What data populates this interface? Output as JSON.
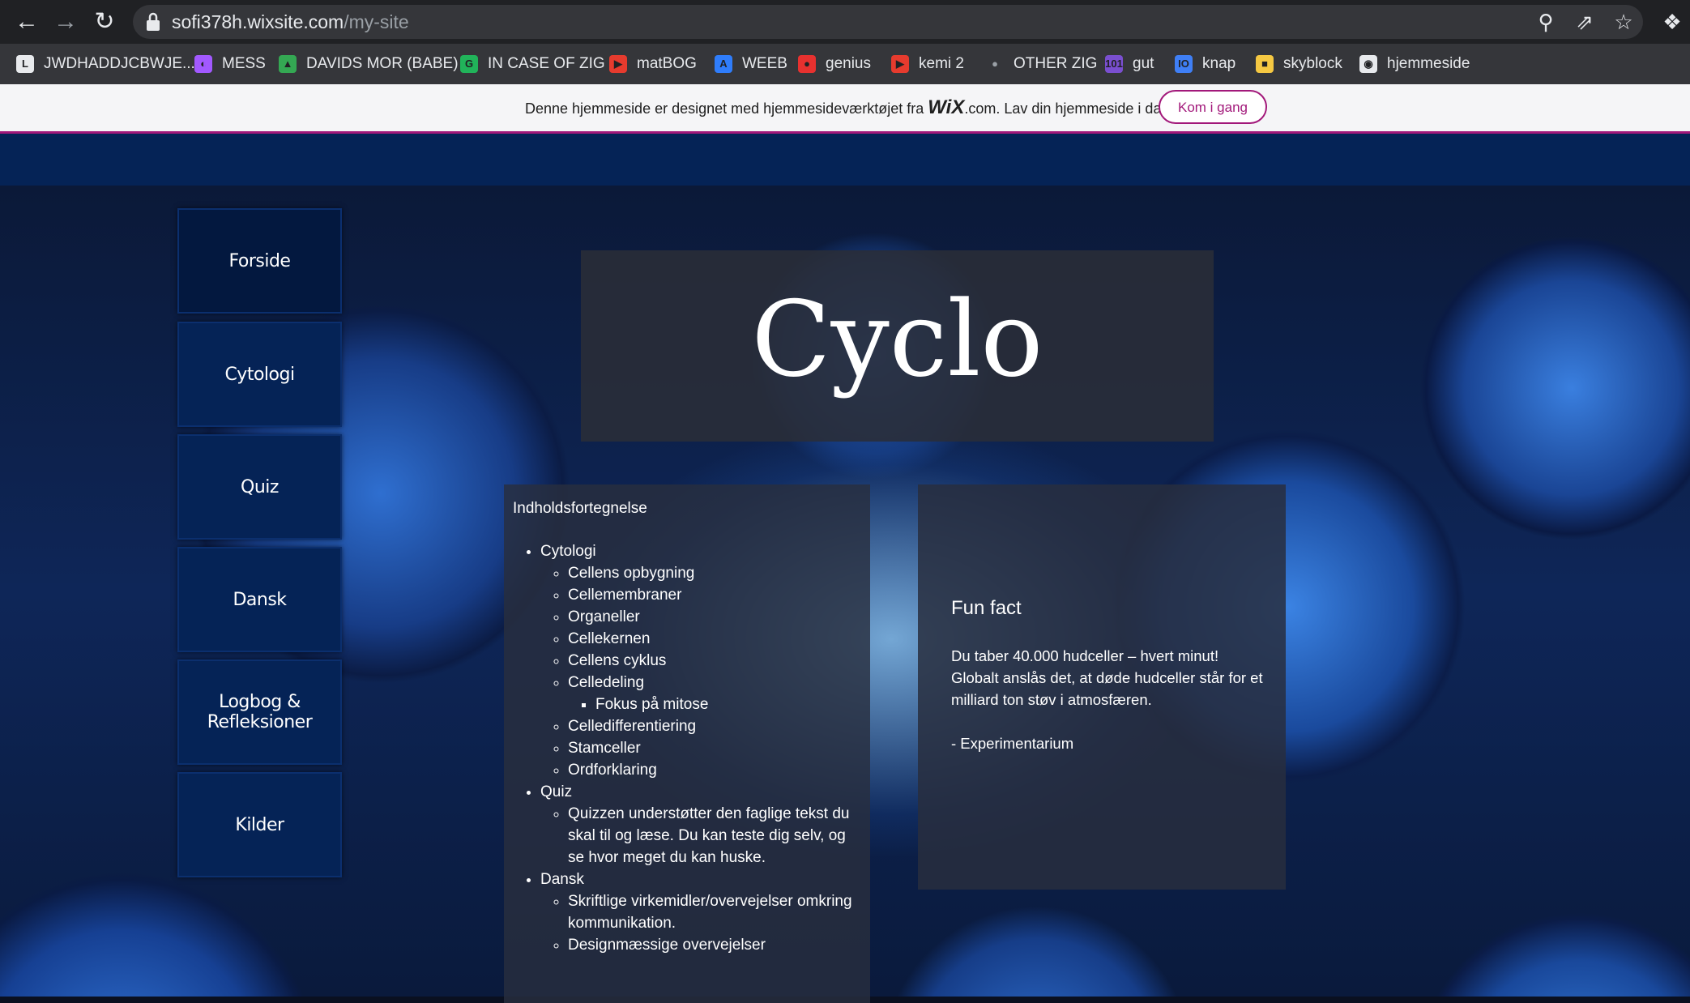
{
  "browser": {
    "url_host": "sofi378h.wixsite.com",
    "url_path": "/my-site",
    "bookmarks": [
      {
        "label": "JWDHADDJCBWJE...",
        "icon": "doc-icon",
        "color": "#e8eaed"
      },
      {
        "label": "MESS",
        "icon": "messenger-icon",
        "color": "#a259ff"
      },
      {
        "label": "DAVIDS MOR (BABE)",
        "icon": "drive-icon",
        "color": "#34a853"
      },
      {
        "label": "IN CASE OF ZIG",
        "icon": "g-circle-icon",
        "color": "#21b35a"
      },
      {
        "label": "matBOG",
        "icon": "play-icon",
        "color": "#e63b2e"
      },
      {
        "label": "WEEB",
        "icon": "a-icon",
        "color": "#2f7dfb"
      },
      {
        "label": "genius",
        "icon": "genius-icon",
        "color": "#e7312f"
      },
      {
        "label": "kemi 2",
        "icon": "play-icon",
        "color": "#e63b2e"
      },
      {
        "label": "OTHER ZIG",
        "icon": "apple-icon",
        "color": "#9aa0a6"
      },
      {
        "label": "gut",
        "icon": "101-icon",
        "color": "#7a4fd0"
      },
      {
        "label": "knap",
        "icon": "io-icon",
        "color": "#3f7ff5"
      },
      {
        "label": "skyblock",
        "icon": "folder-icon",
        "color": "#f5c842"
      },
      {
        "label": "hjemmeside",
        "icon": "globe-icon",
        "color": "#e8eaed"
      }
    ]
  },
  "wix": {
    "text_before": "Denne hjemmeside er designet med hjemmesideværktøjet fra ",
    "brand": "WiX",
    "text_after": ".com. Lav din hjemmeside i dag.",
    "button": "Kom i gang"
  },
  "nav": [
    "Forside",
    "Cytologi",
    "Quiz",
    "Dansk",
    "Logbog & Refleksioner",
    "Kilder"
  ],
  "title": "Cyclo",
  "toc": {
    "heading": "Indholdsfortegnelse",
    "cytologi": "Cytologi",
    "cytologi_items": [
      "Cellens opbygning",
      "Cellemembraner",
      "Organeller",
      "Cellekernen",
      "Cellens cyklus",
      "Celledeling"
    ],
    "celledeling_sub": "Fokus på mitose",
    "cytologi_items2": [
      "Celledifferentiering",
      "Stamceller",
      "Ordforklaring"
    ],
    "quiz": "Quiz",
    "quiz_text": "Quizzen understøtter den faglige tekst du skal til og læse. Du kan teste dig selv, og se hvor meget du kan huske.",
    "dansk": "Dansk",
    "dansk_items": [
      "Skriftlige virkemidler/overvejelser omkring kommunikation.",
      "Designmæssige overvejelser"
    ]
  },
  "fact": {
    "title": "Fun fact",
    "text": "Du taber 40.000 hudceller – hvert minut! Globalt anslås det, at døde hudceller står for et milliard ton støv i atmosfæren.",
    "source": "- Experimentarium"
  },
  "colors": {
    "header": "#052356",
    "wix_accent": "#a2187a"
  }
}
